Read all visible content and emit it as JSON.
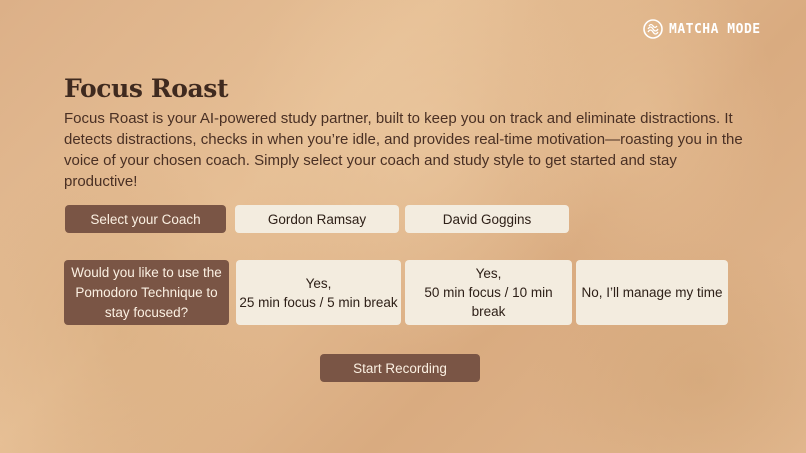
{
  "brand": {
    "name": "MATCHA MODE",
    "logo_icon": "matcha-swirl-icon"
  },
  "main": {
    "title": "Focus Roast",
    "description": "Focus Roast is your AI-powered study partner, built to keep you on track and eliminate distractions. It detects distractions, checks in when you’re idle, and provides real-time motivation—roasting you in the voice of your chosen coach. Simply select your coach and study style to get started and stay productive!"
  },
  "coach": {
    "label": "Select your Coach",
    "options": [
      "Gordon Ramsay",
      "David Goggins"
    ]
  },
  "pomodoro": {
    "question": "Would you like to use the Pomodoro Technique to stay focused?",
    "options": [
      {
        "line1": "Yes,",
        "line2": "25 min focus / 5 min break"
      },
      {
        "line1": "Yes,",
        "line2": "50 min focus / 10 min break"
      },
      {
        "line1": "No, I’ll manage my time"
      }
    ]
  },
  "actions": {
    "start_label": "Start Recording"
  },
  "colors": {
    "background": "#dcb088",
    "dark_button": "#7a5545",
    "light_button": "#f3ecdf",
    "title_text": "#3f2a1f"
  }
}
